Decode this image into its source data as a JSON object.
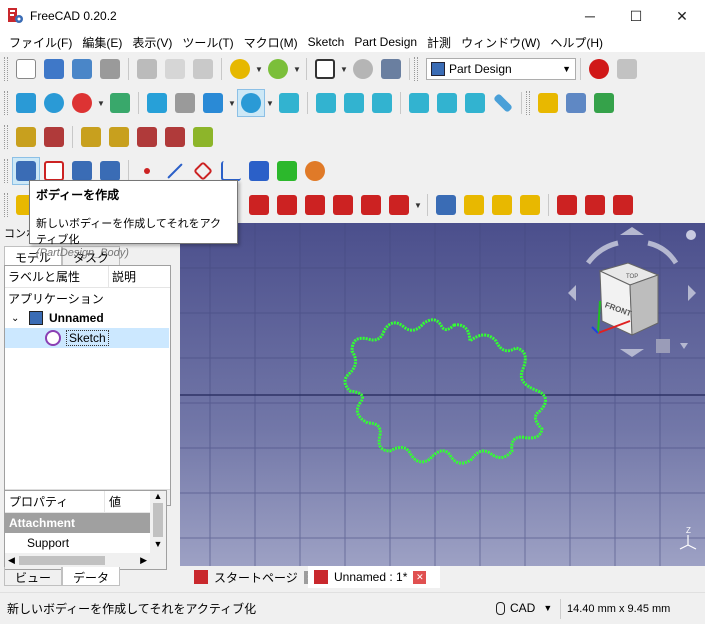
{
  "window": {
    "title": "FreeCAD 0.20.2"
  },
  "menu": [
    "ファイル(F)",
    "編集(E)",
    "表示(V)",
    "ツール(T)",
    "マクロ(M)",
    "Sketch",
    "Part Design",
    "計測",
    "ウィンドウ(W)",
    "ヘルプ(H)"
  ],
  "workbench": {
    "selected": "Part Design"
  },
  "tooltip": {
    "title": "ボディーを作成",
    "description": "新しいボディーを作成してそれをアクティブ化",
    "command": "(PartDesign_Body)"
  },
  "combo": {
    "title": "コンボ",
    "tabs": [
      "モデル",
      "タスク"
    ],
    "tree_header": {
      "label": "ラベルと属性",
      "desc": "説明"
    },
    "tree": [
      {
        "label": "アプリケーション",
        "level": 0
      },
      {
        "label": "Unnamed",
        "level": 1
      },
      {
        "label": "Sketch",
        "level": 2
      }
    ],
    "properties_header": {
      "prop": "プロパティ",
      "value": "値"
    },
    "property_group": "Attachment",
    "property_row": "Support"
  },
  "view_tabs": [
    "ビュー",
    "データ"
  ],
  "doc_tabs": [
    "スタートページ",
    "Unnamed : 1*"
  ],
  "navcube": {
    "top": "TOP",
    "front": "FRONT"
  },
  "status": {
    "message": "新しいボディーを作成してそれをアクティブ化",
    "nav_style": "CAD",
    "dimensions": "14.40 mm x 9.45 mm"
  },
  "colors": {
    "sketch": "#33ff33",
    "accent_blue": "#3a6cb5",
    "record_red": "#d01818",
    "selection": "#cce8ff"
  }
}
